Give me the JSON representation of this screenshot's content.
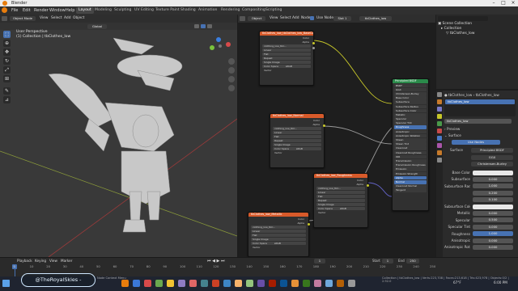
{
  "window": {
    "title": "Blender"
  },
  "menu": {
    "items": [
      "File",
      "Edit",
      "Render",
      "Window",
      "Help"
    ]
  },
  "workspaces": [
    "Layout",
    "Modeling",
    "Sculpting",
    "UV Editing",
    "Texture Paint",
    "Shading",
    "Animation",
    "Rendering",
    "Compositing",
    "Scripting"
  ],
  "viewport": {
    "mode": "Object Mode",
    "menus": [
      "View",
      "Select",
      "Add",
      "Object"
    ],
    "orientation": "Global",
    "info_line1": "User Perspective",
    "info_line2": "(1) Collection | tbClothes_low"
  },
  "node_editor": {
    "header_items": [
      "Object",
      "View",
      "Select",
      "Add",
      "Node"
    ],
    "use_nodes_label": "Use Nodes",
    "slot_label": "Slot 1",
    "material_name": "tbClothes_low",
    "tex_nodes": [
      {
        "title": "tbClothes_low_tbClothes_low_BaseColor",
        "image": "clothing_low_tbC...",
        "rows": [
          "Linear",
          "Flat",
          "Repeat",
          "Single Image"
        ],
        "colorspace_label": "Color Space",
        "colorspace": "sRGB",
        "vector": "Vector"
      },
      {
        "title": "tbClothes_low_Normal",
        "image": "clothing_low_tbC...",
        "rows": [
          "Linear",
          "Flat",
          "Repeat",
          "Single Image"
        ],
        "colorspace_label": "Color Space",
        "colorspace": "sRGB",
        "vector": "Vector"
      },
      {
        "title": "tbClothes_low_Roughness",
        "image": "clothing_low_tbC...",
        "rows": [
          "Linear",
          "Flat",
          "Repeat",
          "Single Image"
        ],
        "colorspace_label": "Color Space",
        "colorspace": "sRGB",
        "vector": "Vector"
      },
      {
        "title": "tbClothes_low_Metallic",
        "image": "clothing_low_tbC...",
        "rows": [
          "Linear",
          "Flat",
          "Single Image"
        ],
        "colorspace_label": "Color Space",
        "colorspace": "sRGB",
        "vector": "Vector"
      }
    ],
    "principled": {
      "title": "Principled BSDF",
      "rows": [
        "BSDF",
        "GGX",
        "Christensen-Burley",
        "Base Color",
        "Subsurface",
        "Subsurface Radius",
        "Subsurface Color",
        "Metallic",
        "Specular",
        "Specular Tint",
        "Roughness",
        "Anisotropic",
        "Anisotropic Rotation",
        "Sheen",
        "Sheen Tint",
        "Clearcoat",
        "Clearcoat Roughness",
        "IOR",
        "Transmission",
        "Transmission Roughness",
        "Emission",
        "Emission Strength",
        "Alpha",
        "Normal",
        "Clearcoat Normal",
        "Tangent"
      ],
      "highlighted": [
        10,
        22,
        23
      ]
    },
    "output_labels": {
      "color": "Color",
      "alpha": "Alpha"
    }
  },
  "outliner": {
    "rows": [
      "Scene Collection",
      "Collection",
      "tbClothes_low"
    ]
  },
  "properties": {
    "object_name": "tbClothes_low",
    "material_slot": "tbClothes_low",
    "material_field": "tbClothes_low",
    "preview_label": "Preview",
    "surface_label": "Surface",
    "use_nodes": "Use Nodes",
    "surface_field_label": "Surface",
    "surface_value": "Principled BSDF",
    "dist1": "GGX",
    "dist2": "Christensen-Burley",
    "params": [
      {
        "label": "Base Color",
        "value": ""
      },
      {
        "label": "Subsurface",
        "value": "0.000"
      },
      {
        "label": "Subsurface Radius",
        "value": "1.000"
      },
      {
        "label": "",
        "value": "0.200"
      },
      {
        "label": "",
        "value": "0.100"
      },
      {
        "label": "Subsurface Color",
        "value": ""
      },
      {
        "label": "Metallic",
        "value": "0.000"
      },
      {
        "label": "Specular",
        "value": "0.500"
      },
      {
        "label": "Specular Tint",
        "value": "0.000"
      },
      {
        "label": "Roughness",
        "value": "1.000"
      },
      {
        "label": "Anisotropic",
        "value": "0.000"
      },
      {
        "label": "Anisotropic Rotati...",
        "value": "0.000"
      }
    ]
  },
  "timeline": {
    "menus": [
      "Playback",
      "Keying",
      "View",
      "Marker"
    ],
    "ticks": [
      "0",
      "10",
      "20",
      "30",
      "40",
      "50",
      "60",
      "70",
      "80",
      "90",
      "100",
      "110",
      "120",
      "130",
      "140",
      "150",
      "160",
      "170",
      "180",
      "190",
      "200",
      "210",
      "220",
      "230",
      "240",
      "250"
    ],
    "start_label": "Start",
    "start": "1",
    "end_label": "End",
    "end": "250",
    "current": "1"
  },
  "status": {
    "left": "Node Context Menu",
    "right": "Collection | tbClothes_low | Verts:223,708 | Faces:213,618 | Tris:423,978 | Objects:0/2 | 2.92.0"
  },
  "watermark": "@TheRoyalSkies -",
  "taskbar": {
    "time": "6:00 PM",
    "weather": "67°F"
  }
}
